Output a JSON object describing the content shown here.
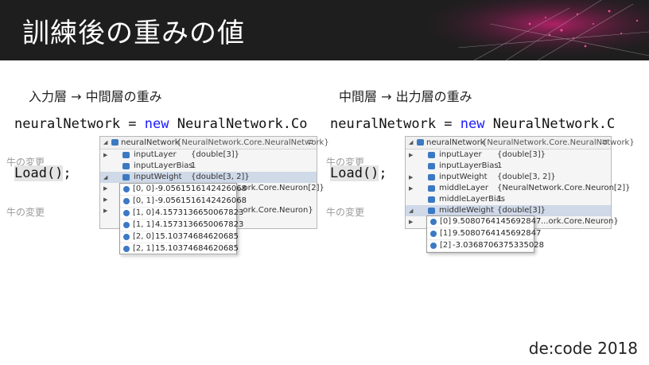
{
  "slide": {
    "title": "訓練後の重みの値",
    "footer": "de:code 2018"
  },
  "left": {
    "caption": "入力層 → 中間層の重み",
    "code_var": "neuralNetwork",
    "code_eq": " = ",
    "code_kw": "new",
    "code_cls": " NeuralNetwork.Co",
    "faded1": "牛の変更",
    "faded2": "牛の変更",
    "load": "Load()",
    "load_tail": ";",
    "datatip": {
      "header_name": "neuralNetwork",
      "header_value": "{NeuralNetwork.Core.NeuralNetwork}",
      "rows": [
        {
          "name": "inputLayer",
          "value": "{double[3]}"
        },
        {
          "name": "inputLayerBias",
          "value": "1"
        },
        {
          "name": "inputWeight",
          "value": "{double[3, 2]}"
        },
        {
          "name": "",
          "value": "...ork.Core.Neuron[2]}"
        },
        {
          "name": "",
          "value": ""
        },
        {
          "name": "",
          "value": "...ork.Core.Neuron}"
        }
      ],
      "popup": [
        {
          "index": "[0, 0]",
          "value": "-9.0561516142426068"
        },
        {
          "index": "[0, 1]",
          "value": "-9.0561516142426068"
        },
        {
          "index": "[1, 0]",
          "value": "4.1573136650067823"
        },
        {
          "index": "[1, 1]",
          "value": "4.1573136650067823"
        },
        {
          "index": "[2, 0]",
          "value": "15.10374684620685"
        },
        {
          "index": "[2, 1]",
          "value": "15.10374684620685"
        }
      ]
    }
  },
  "right": {
    "caption": "中間層 → 出力層の重み",
    "code_var": "neuralNetwork",
    "code_eq": " = ",
    "code_kw": "new",
    "code_cls": " NeuralNetwork.C",
    "faded1": "牛の変更",
    "faded2": "牛の変更",
    "load": "Load()",
    "load_tail": ";",
    "datatip": {
      "header_name": "neuralNetwork",
      "header_value": "{NeuralNetwork.Core.NeuralNetwork}",
      "rows": [
        {
          "name": "inputLayer",
          "value": "{double[3]}"
        },
        {
          "name": "inputLayerBias",
          "value": "1"
        },
        {
          "name": "inputWeight",
          "value": "{double[3, 2]}"
        },
        {
          "name": "middleLayer",
          "value": "{NeuralNetwork.Core.Neuron[2]}"
        },
        {
          "name": "middleLayerBias",
          "value": "1"
        },
        {
          "name": "middleWeight",
          "value": "{double[3]}"
        },
        {
          "name": "",
          "value": "...ork.Core.Neuron}"
        }
      ],
      "popup": [
        {
          "index": "[0]",
          "value": "9.5080764145692847"
        },
        {
          "index": "[1]",
          "value": "9.5080764145692847"
        },
        {
          "index": "[2]",
          "value": "-3.0368706375335028"
        }
      ]
    }
  }
}
